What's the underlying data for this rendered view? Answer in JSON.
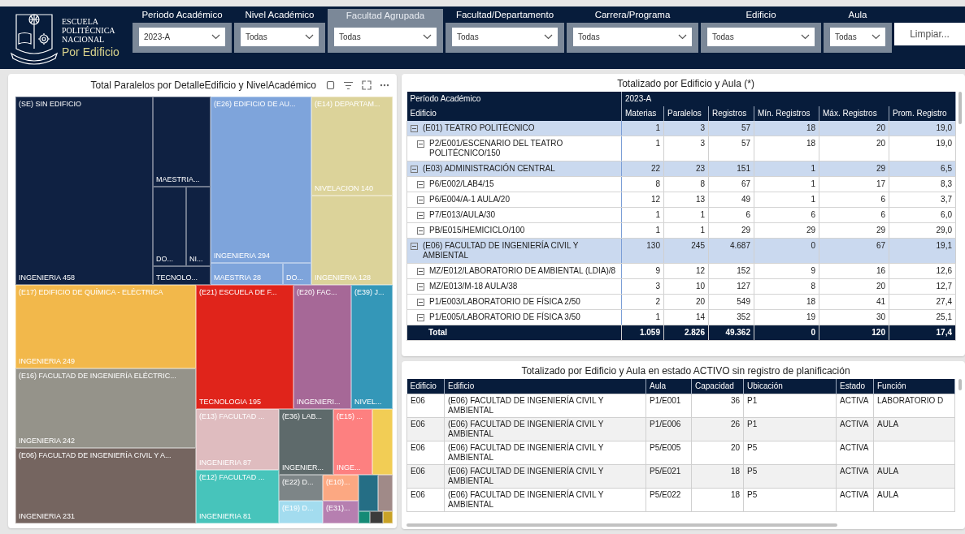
{
  "header": {
    "logo_lines": [
      "ESCUELA",
      "POLITÉCNICA",
      "NACIONAL"
    ],
    "page_title": "Por Edificio",
    "filters": [
      {
        "label": "Periodo Académico",
        "value": "2023-A",
        "highlighted": false
      },
      {
        "label": "Nivel Académico",
        "value": "Todas",
        "highlighted": false
      },
      {
        "label": "Facultad Agrupada",
        "value": "Todas",
        "highlighted": true
      },
      {
        "label": "Facultad/Departamento",
        "value": "Todas",
        "highlighted": false
      },
      {
        "label": "Carrera/Programa",
        "value": "Todas",
        "highlighted": false
      },
      {
        "label": "Edificio",
        "value": "Todas",
        "highlighted": false
      },
      {
        "label": "Aula",
        "value": "Todas",
        "highlighted": false
      }
    ],
    "clear_button": "Limpiar..."
  },
  "treemap": {
    "title": "Total Paralelos por DetalleEdificio y NivelAcadémico",
    "tiles": [
      {
        "top": "(SE) SIN EDIFICIO",
        "bottom": "INGENIERIA 458",
        "color": "#0f2142"
      },
      {
        "bottom": "MAESTRIA...",
        "color": "#0f2142"
      },
      {
        "bottom": "DO...",
        "color": "#0f2142"
      },
      {
        "bottom": "NI...",
        "color": "#0f2142"
      },
      {
        "bottom": "TECNOLO...",
        "color": "#0f2142"
      },
      {
        "top": "(E26) EDIFICIO DE AU...",
        "bottom": "INGENIERIA 294",
        "color": "#7ea4db"
      },
      {
        "bottom": "MAESTRIA 28",
        "color": "#7ea4db"
      },
      {
        "bottom": "DO...",
        "color": "#7ea4db"
      },
      {
        "top": "(E14) DEPARTAM...",
        "bottom": "NIVELACION 140",
        "color": "#dcd39a"
      },
      {
        "bottom": "INGENIERIA 128",
        "color": "#dcd39a"
      },
      {
        "top": "(E17) EDIFICIO DE QUÍMICA - ELÉCTRICA",
        "bottom": "INGENIERIA 249",
        "color": "#f2b84b"
      },
      {
        "top": "(E16) FACULTAD DE INGENIERÍA ELÉCTRIC...",
        "bottom": "INGENIERIA 242",
        "color": "#95938a"
      },
      {
        "top": "(E06) FACULTAD DE INGENIERÍA CIVIL Y A...",
        "bottom": "INGENIERIA 231",
        "color": "#756560"
      },
      {
        "top": "(E21) ESCUELA DE F...",
        "bottom": "TECNOLOGIA 195",
        "color": "#e0241b"
      },
      {
        "top": "(E20) FAC...",
        "bottom": "INGENIERI...",
        "color": "#a66897"
      },
      {
        "top": "(E39) J...",
        "bottom": "NIVEL...",
        "color": "#3497b8"
      },
      {
        "top": "(E13) FACULTAD ...",
        "bottom": "INGENIERIA 87",
        "color": "#dfbcbf"
      },
      {
        "top": "(E12) FACULTAD ...",
        "bottom": "INGENIERIA 81",
        "color": "#47c4bb"
      },
      {
        "top": "(E36) LAB...",
        "bottom": "INGENIER...",
        "color": "#5e6a6b"
      },
      {
        "top": "(E15) ...",
        "bottom": "INGE...",
        "color": "#fd8080"
      },
      {
        "color": "#f2cd55"
      },
      {
        "top": "(E22) D...",
        "color": "#7d8587"
      },
      {
        "top": "(E10)...",
        "color": "#fca882"
      },
      {
        "top": "(E19) D...",
        "color": "#a3dcef"
      },
      {
        "top": "(E31)...",
        "color": "#b67fb0"
      },
      {
        "color": "#256e85"
      },
      {
        "color": "#a08a88"
      },
      {
        "color": "#158a76"
      },
      {
        "color": "#3b3b3b"
      },
      {
        "color": "#c9a227"
      }
    ]
  },
  "summary_table": {
    "title": "Totalizado por Edificio y Aula (*)",
    "period_label": "Período Académico",
    "period_value": "2023-A",
    "row_header": "Edificio",
    "columns": [
      "Materias",
      "Paralelos",
      "Registros",
      "Mín. Registros",
      "Máx. Registros",
      "Prom. Registro"
    ],
    "rows": [
      {
        "kind": "group",
        "name": "(E01) TEATRO POLITÉCNICO",
        "values": [
          "1",
          "3",
          "57",
          "18",
          "20",
          "19,0"
        ]
      },
      {
        "kind": "item",
        "name": "P2/E001/ESCENARIO DEL TEATRO POLITÉCNICO/150",
        "values": [
          "1",
          "3",
          "57",
          "18",
          "20",
          "19,0"
        ]
      },
      {
        "kind": "group",
        "name": "(E03) ADMINISTRACIÓN CENTRAL",
        "values": [
          "22",
          "23",
          "151",
          "1",
          "29",
          "6,5"
        ]
      },
      {
        "kind": "item",
        "name": "P6/E002/LAB4/15",
        "values": [
          "8",
          "8",
          "67",
          "1",
          "17",
          "8,3"
        ]
      },
      {
        "kind": "item",
        "name": "P6/E004/A-1 AULA/20",
        "values": [
          "12",
          "13",
          "49",
          "1",
          "6",
          "3,7"
        ]
      },
      {
        "kind": "item",
        "name": "P7/E013/AULA/30",
        "values": [
          "1",
          "1",
          "6",
          "6",
          "6",
          "6,0"
        ]
      },
      {
        "kind": "item",
        "name": "PB/E015/HEMICICLO/100",
        "values": [
          "1",
          "1",
          "29",
          "29",
          "29",
          "29,0"
        ]
      },
      {
        "kind": "group",
        "name": "(E06) FACULTAD DE INGENIERÍA CIVIL Y AMBIENTAL",
        "values": [
          "130",
          "245",
          "4.687",
          "0",
          "67",
          "19,1"
        ]
      },
      {
        "kind": "item",
        "name": "MZ/E012/LABORATORIO DE AMBIENTAL (LDIA)/8",
        "values": [
          "9",
          "12",
          "152",
          "9",
          "16",
          "12,6"
        ]
      },
      {
        "kind": "item",
        "name": "MZ/E013/M-18 AULA/38",
        "values": [
          "3",
          "10",
          "127",
          "8",
          "20",
          "12,7"
        ]
      },
      {
        "kind": "item",
        "name": "P1/E003/LABORATORIO DE FÍSICA 2/50",
        "values": [
          "2",
          "20",
          "549",
          "18",
          "41",
          "27,4"
        ]
      },
      {
        "kind": "item",
        "name": "P1/E005/LABORATORIO DE FÍSICA 3/50",
        "values": [
          "1",
          "14",
          "352",
          "19",
          "30",
          "25,1"
        ]
      }
    ],
    "total": {
      "label": "Total",
      "values": [
        "1.059",
        "2.826",
        "49.362",
        "0",
        "120",
        "17,4"
      ]
    }
  },
  "active_table": {
    "title": "Totalizado por Edificio y Aula en estado ACTIVO sin registro de planificación",
    "columns": [
      "Edificio",
      "Edificio",
      "Aula",
      "Capacidad",
      "Ubicación",
      "Estado",
      "Función"
    ],
    "rows": [
      [
        "E06",
        "(E06) FACULTAD DE INGENIERÍA CIVIL Y AMBIENTAL",
        "P1/E001",
        "36",
        "P1",
        "ACTIVA",
        "LABORATORIO D"
      ],
      [
        "E06",
        "(E06) FACULTAD DE INGENIERÍA CIVIL Y AMBIENTAL",
        "P1/E006",
        "26",
        "P1",
        "ACTIVA",
        "AULA"
      ],
      [
        "E06",
        "(E06) FACULTAD DE INGENIERÍA CIVIL Y AMBIENTAL",
        "P5/E005",
        "20",
        "P5",
        "ACTIVA"
      ],
      [
        "E06",
        "(E06) FACULTAD DE INGENIERÍA CIVIL Y AMBIENTAL",
        "P5/E021",
        "18",
        "P5",
        "ACTIVA",
        "AULA"
      ],
      [
        "E06",
        "(E06) FACULTAD DE INGENIERÍA CIVIL Y AMBIENTAL",
        "P5/E022",
        "18",
        "P5",
        "ACTIVA",
        "AULA"
      ]
    ]
  }
}
